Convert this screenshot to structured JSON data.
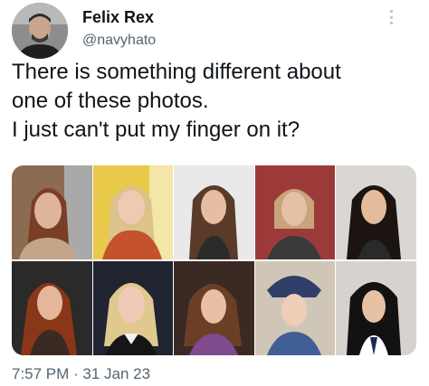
{
  "tweet": {
    "author": {
      "display_name": "Felix Rex",
      "handle": "@navyhato",
      "avatar": "person-photo"
    },
    "menu_icon": "more-vertical-icon",
    "text_lines": [
      "There is something different about",
      "one of these photos.",
      "I just can't put my finger on it?"
    ],
    "media": {
      "layout": "2 rows x 5 columns photo grid",
      "rows": [
        [
          "portrait-photo",
          "portrait-photo",
          "portrait-photo",
          "portrait-photo",
          "portrait-photo"
        ],
        [
          "portrait-photo",
          "portrait-photo",
          "portrait-photo",
          "portrait-photo",
          "portrait-photo"
        ]
      ]
    },
    "timestamp": "7:57 PM · 31 Jan 23"
  },
  "colors": {
    "text": "#0f1419",
    "secondary_text": "#536471",
    "background": "#ffffff"
  }
}
